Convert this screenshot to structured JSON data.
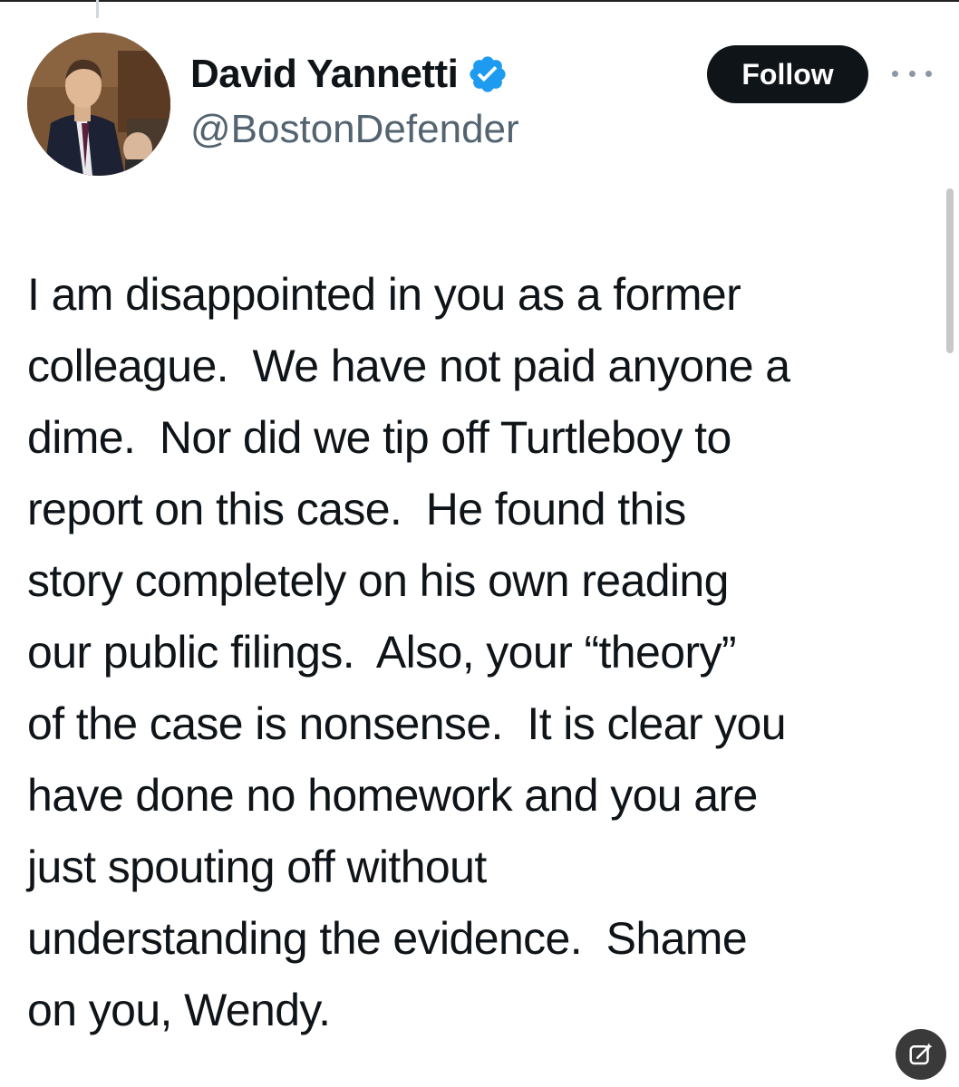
{
  "author": {
    "display_name": "David Yannetti",
    "handle": "@BostonDefender",
    "verified": true,
    "avatar_icon": "profile-photo"
  },
  "actions": {
    "follow_label": "Follow",
    "more_icon": "more-horizontal-icon",
    "floating_icon": "grok-edit-icon"
  },
  "tweet": {
    "text": "I am disappointed in you as a former\ncolleague.  We have not paid anyone a\ndime.  Nor did we tip off Turtleboy to\nreport on this case.  He found this\nstory completely on his own reading\nour public filings.  Also, your “theory”\nof the case is nonsense.  It is clear you\nhave done no homework and you are\njust spouting off without\nunderstanding the evidence.  Shame\non you, Wendy."
  },
  "colors": {
    "verified_blue": "#1d9bf0",
    "follow_bg": "#0f1419",
    "handle_gray": "#536471"
  }
}
